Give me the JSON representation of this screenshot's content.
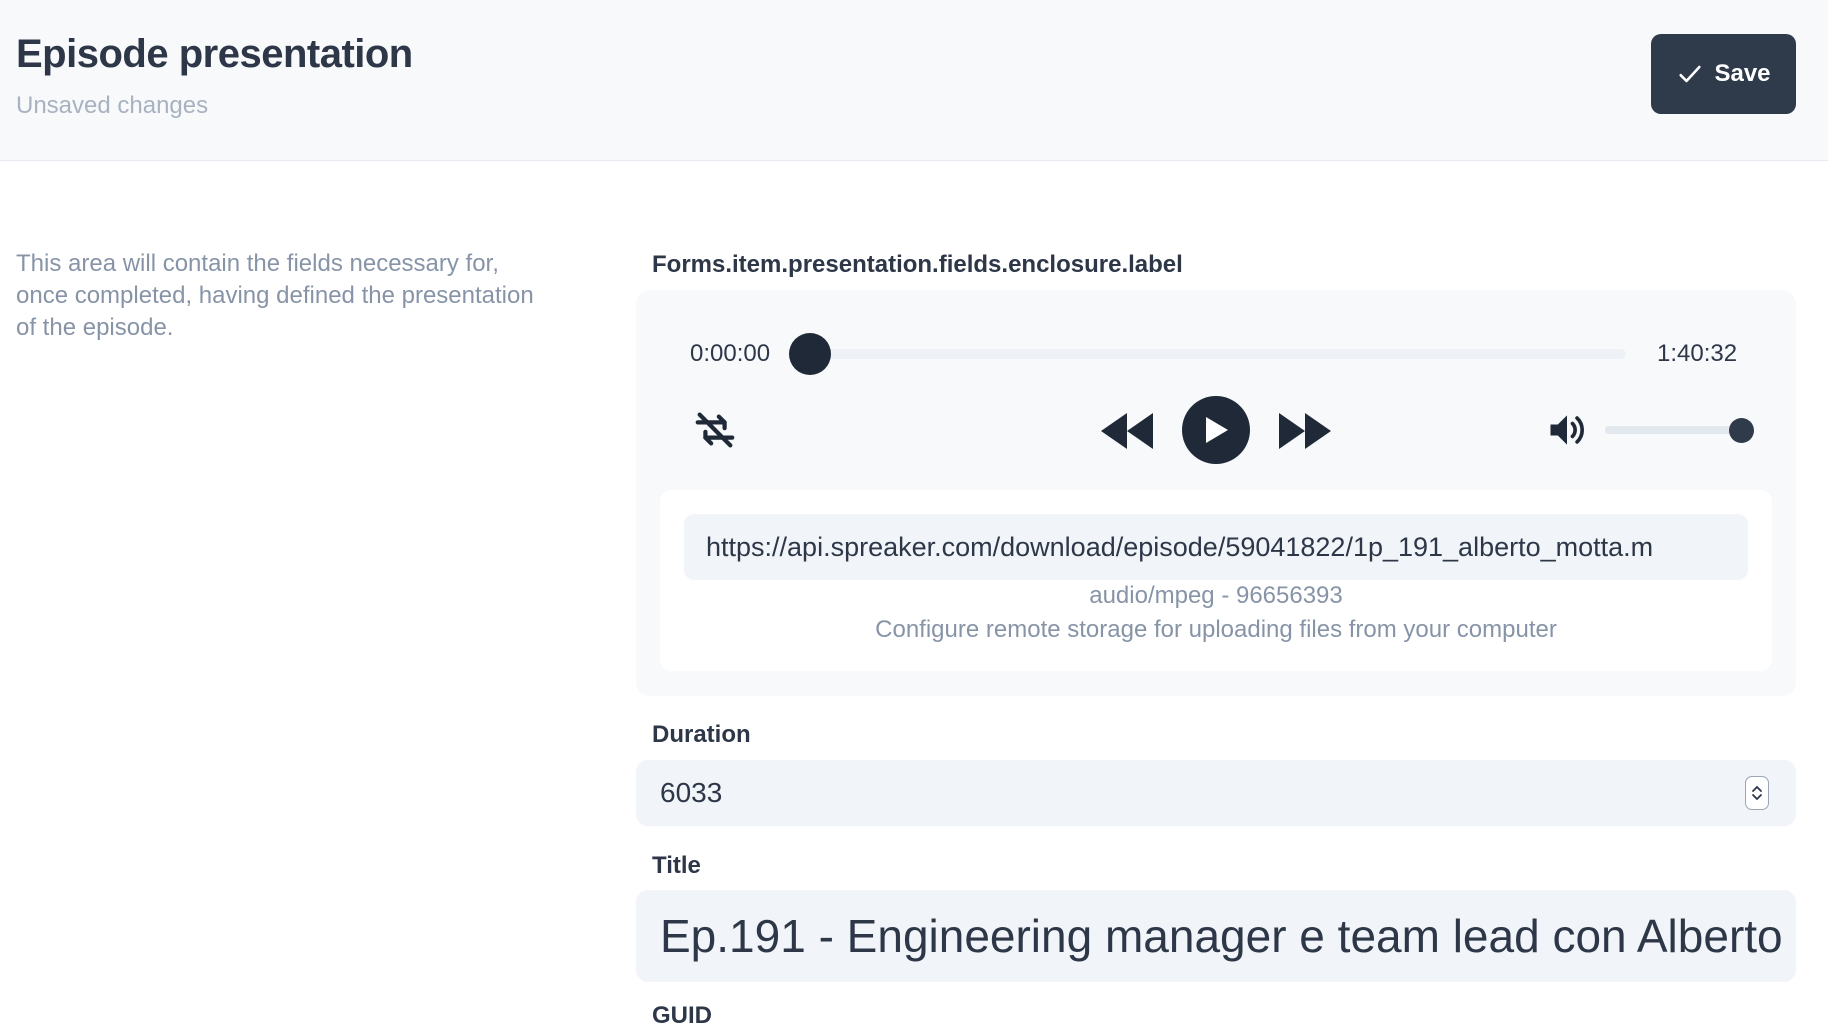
{
  "header": {
    "title": "Episode presentation",
    "status": "Unsaved changes",
    "save_label": "Save"
  },
  "intro_text": "This area will contain the fields necessary for, once completed, having defined the presentation of the episode.",
  "enclosure": {
    "label": "Forms.item.presentation.fields.enclosure.label",
    "player": {
      "current_time": "0:00:00",
      "total_time": "1:40:32",
      "progress_fraction": 0.0,
      "volume_fraction": 1.0
    },
    "url_value": "https://api.spreaker.com/download/episode/59041822/1p_191_alberto_motta.m",
    "mime_info": "audio/mpeg - 96656393",
    "storage_hint": "Configure remote storage for uploading files from your computer"
  },
  "duration": {
    "label": "Duration",
    "value": "6033"
  },
  "title_field": {
    "label": "Title",
    "value": "Ep.191 - Engineering manager e team lead con Alberto"
  },
  "next_field": {
    "label": "GUID"
  }
}
